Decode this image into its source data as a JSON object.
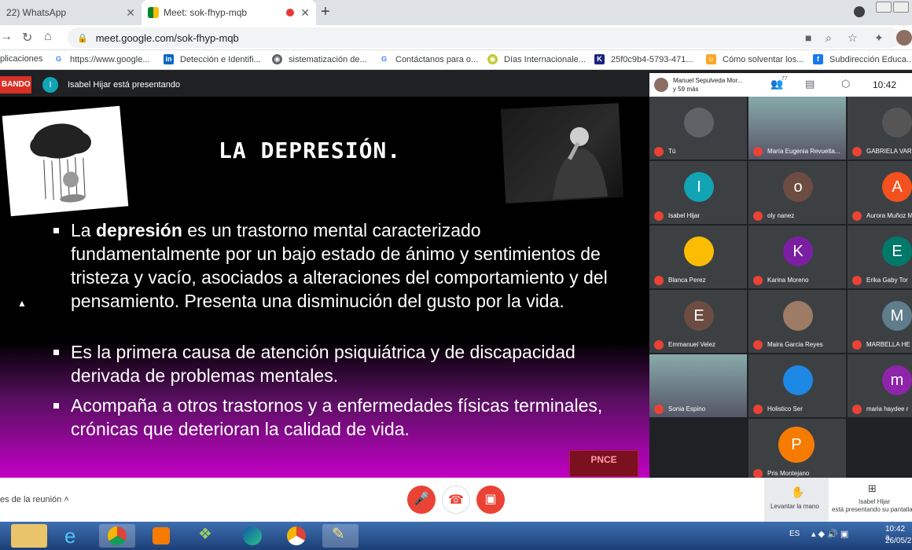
{
  "browser": {
    "tabs": [
      {
        "title": "22) WhatsApp",
        "active": false
      },
      {
        "title": "Meet: sok-fhyp-mqb",
        "active": true
      }
    ],
    "new_tab": "+",
    "url": "meet.google.com/sok-fhyp-mqb"
  },
  "bookmarks": [
    {
      "label": "plicaciones",
      "icon": "apps-grid-icon"
    },
    {
      "label": "https://www.google...",
      "icon": "google-g-icon"
    },
    {
      "label": "Detección e Identifi...",
      "icon": "linkedin-icon"
    },
    {
      "label": "sistematización de...",
      "icon": "globe-icon"
    },
    {
      "label": "Contáctanos para o...",
      "icon": "google-g-icon"
    },
    {
      "label": "Días Internacionale...",
      "icon": "globe-icon"
    },
    {
      "label": "25f0c9b4-5793-471...",
      "icon": "k-icon"
    },
    {
      "label": "Cómo solventar los...",
      "icon": "person-icon"
    },
    {
      "label": "Subdirección Educa...",
      "icon": "facebook-icon"
    }
  ],
  "meet": {
    "recording_badge": "BANDO",
    "presenter_initial": "I",
    "presenter_text": "Isabel Hijar está presentando",
    "top_speaker": "Manuel Sepulveda Mor...",
    "top_speaker_more": "y 59 más",
    "participants_count": "77",
    "time": "10:42",
    "accent_red": "#ea4335"
  },
  "slide": {
    "title": "LA DEPRESIÓN.",
    "bullets": [
      {
        "prefix": "La ",
        "bold": "depresión",
        "rest": " es un trastorno mental caracterizado fundamentalmente por un bajo estado de ánimo y sentimientos de tristeza y vacío, asociados a alteraciones del comportamiento y del pensamiento. Presenta una disminución del gusto por la vida."
      },
      {
        "prefix": "",
        "bold": "",
        "rest": "Es la primera causa de atención psiquiátrica y de discapacidad derivada de problemas mentales."
      },
      {
        "prefix": "",
        "bold": "",
        "rest": "Acompaña a otros trastornos y a enfermedades físicas terminales, crónicas que deterioran la calidad de vida."
      }
    ],
    "logo_text": "PNCE"
  },
  "participants": [
    {
      "name": "Tú",
      "initial": "",
      "color": "#5f6368",
      "photo": true
    },
    {
      "name": "María Eugenia Revuelta...",
      "initial": "",
      "color": "#8d8d8d",
      "photo": true
    },
    {
      "name": "GABRIELA VAR",
      "initial": "",
      "color": "#555",
      "photo": true
    },
    {
      "name": "Isabel Hijar",
      "initial": "I",
      "color": "#12a4b4",
      "photo": false
    },
    {
      "name": "oly nanez",
      "initial": "o",
      "color": "#6d4c41",
      "photo": false
    },
    {
      "name": "Aurora Muñoz M",
      "initial": "A",
      "color": "#f4511e",
      "photo": false
    },
    {
      "name": "Blanca Perez",
      "initial": "",
      "color": "#fbbc04",
      "photo": true
    },
    {
      "name": "Karina Moreno",
      "initial": "K",
      "color": "#7b1fa2",
      "photo": false
    },
    {
      "name": "Erika Gaby Tor",
      "initial": "E",
      "color": "#00796b",
      "photo": false
    },
    {
      "name": "Emmanuel Velez",
      "initial": "E",
      "color": "#6d4c41",
      "photo": false
    },
    {
      "name": "Maira Garcia Reyes",
      "initial": "",
      "color": "#9e7b65",
      "photo": true
    },
    {
      "name": "MARBELLA HE",
      "initial": "M",
      "color": "#607d8b",
      "photo": false
    },
    {
      "name": "Sonia Espino",
      "initial": "",
      "color": "#4e8a8a",
      "photo": true
    },
    {
      "name": "Holistico Ser",
      "initial": "",
      "color": "#1e88e5",
      "photo": true
    },
    {
      "name": "maria haydee r",
      "initial": "m",
      "color": "#8e24aa",
      "photo": false
    },
    {
      "name": "Pris Montejano",
      "initial": "P",
      "color": "#f57c00",
      "photo": false
    }
  ],
  "bottom": {
    "details_label": "es de la reunión",
    "raise_hand": "Levantar la mano",
    "presenting_name": "Isabel Hijar",
    "presenting_text": "está presentando su pantalla"
  },
  "taskbar": {
    "lang": "ES",
    "time": "10:42 a.",
    "date": "26/05/2"
  }
}
